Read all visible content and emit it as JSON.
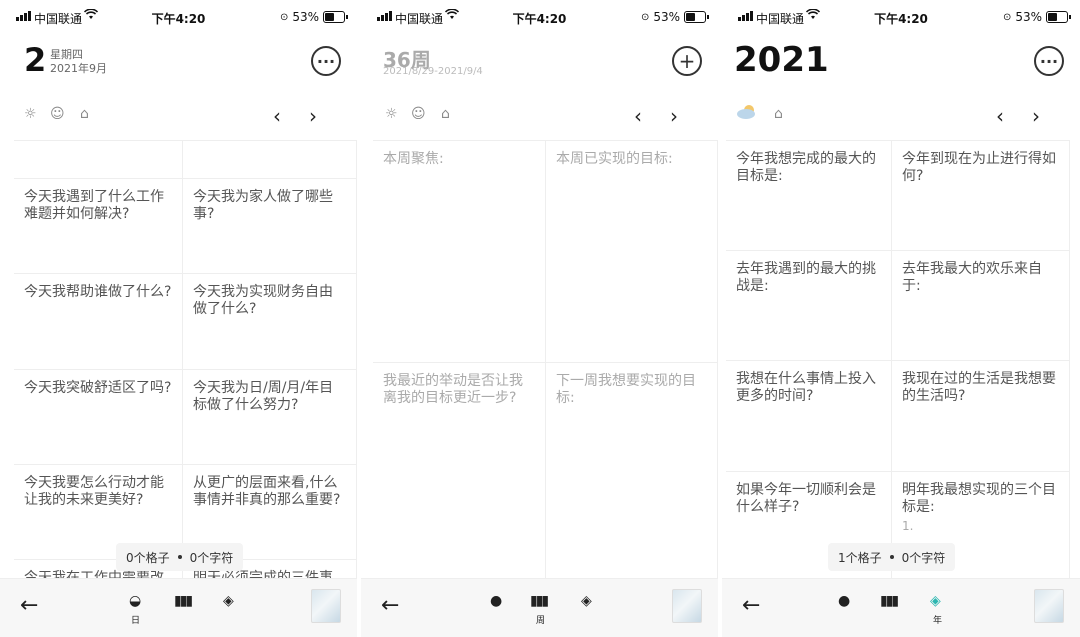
{
  "status": {
    "carrier": "中国联通",
    "time": "下午4:20",
    "battery": "53%"
  },
  "panels": [
    {
      "title": "2",
      "weekday": "星期四",
      "month": "2021年9月",
      "action_icon": "more-icon",
      "cells": [
        "",
        "",
        "今天我遇到了什么工作难题并如何解决?",
        "今天我为家人做了哪些事?",
        "今天我帮助谁做了什么?",
        "今天我为实现财务自由做了什么?",
        "今天我突破舒适区了吗?",
        "今天我为日/周/月/年目标做了什么努力?",
        "今天我要怎么行动才能让我的未来更美好?",
        "从更广的层面来看,什么事情并非真的那么重要?",
        "今天我在工作中需要改",
        "明天必须完成的三件事"
      ],
      "counter": {
        "cells": "0个格子",
        "chars": "0个字符"
      },
      "active_tab": "日"
    },
    {
      "title": "36周",
      "range": "2021/8/29-2021/9/4",
      "action_icon": "add-icon",
      "cells": [
        "本周聚焦:",
        "本周已实现的目标:",
        "我最近的举动是否让我离我的目标更近一步?",
        "下一周我想要实现的目标:"
      ],
      "active_tab": "周"
    },
    {
      "title": "2021",
      "action_icon": "more-icon",
      "cells": [
        "今年我想完成的最大的目标是:",
        "今年到现在为止进行得如何?",
        "去年我遇到的最大的挑战是:",
        "去年我最大的欢乐来自于:",
        "我想在什么事情上投入更多的时间?",
        "我现在过的生活是我想要的生活吗?",
        "如果今年一切顺利会是什么样子?",
        "明年我最想实现的三个目标是:"
      ],
      "list_marker": "1.",
      "counter": {
        "cells": "1个格子",
        "chars": "0个字符"
      },
      "active_tab": "年"
    }
  ]
}
